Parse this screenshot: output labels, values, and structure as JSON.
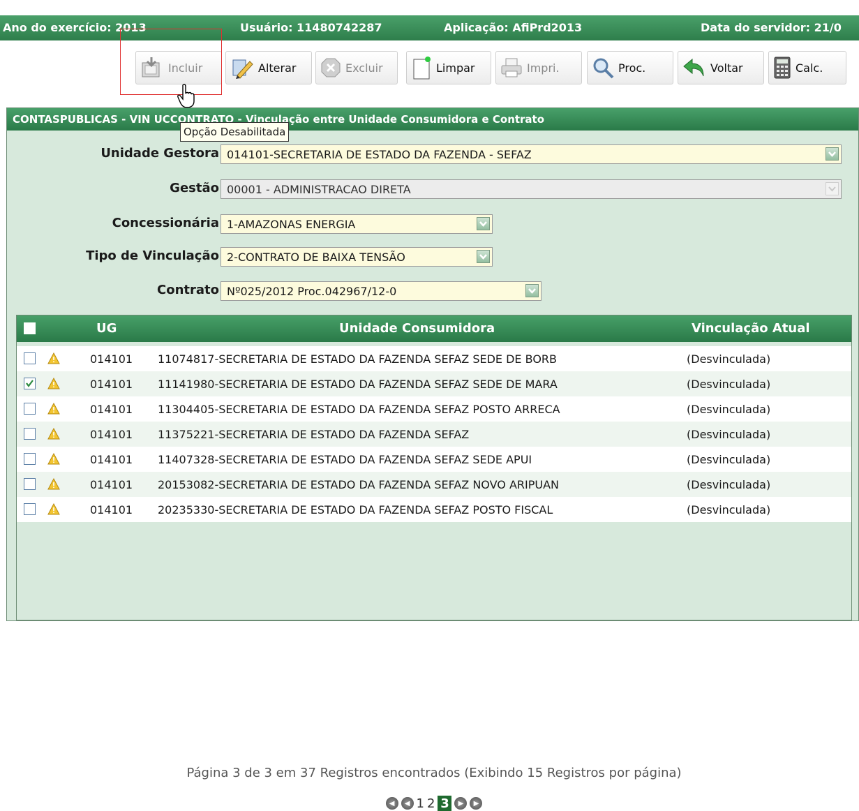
{
  "topbar": {
    "ano": "Ano do exercício: 2013",
    "usuario": "Usuário: 11480742287",
    "aplicacao": "Aplicação: AfiPrd2013",
    "data_servidor": "Data do servidor: 21/0"
  },
  "toolbar": {
    "incluir": "Incluir",
    "alterar": "Alterar",
    "excluir": "Excluir",
    "limpar": "Limpar",
    "imprimir": "Impri.",
    "proc": "Proc.",
    "voltar": "Voltar",
    "calc": "Calc."
  },
  "tooltip": "Opção Desabilitada",
  "panel": {
    "title": "CONTASPUBLICAS - VIN                              UCCONTRATO - Vinculação entre Unidade Consumidora e Contrato"
  },
  "form": {
    "unidade_gestora_label": "Unidade Gestora",
    "unidade_gestora_value": "014101-SECRETARIA DE ESTADO DA FAZENDA - SEFAZ",
    "gestao_label": "Gestão",
    "gestao_value": "00001 - ADMINISTRACAO DIRETA",
    "concessionaria_label": "Concessionária",
    "concessionaria_value": "1-AMAZONAS ENERGIA",
    "tipo_label": "Tipo de Vinculação",
    "tipo_value": "2-CONTRATO DE BAIXA TENSÃO",
    "contrato_label": "Contrato",
    "contrato_value": "Nº025/2012 Proc.042967/12-0"
  },
  "grid": {
    "headers": {
      "ug": "UG",
      "unidade": "Unidade Consumidora",
      "vinculacao": "Vinculação Atual"
    },
    "rows": [
      {
        "checked": false,
        "ug": "014101",
        "unidade": "11074817-SECRETARIA DE ESTADO DA FAZENDA SEFAZ SEDE DE BORB",
        "vinc": "(Desvinculada)"
      },
      {
        "checked": true,
        "ug": "014101",
        "unidade": "11141980-SECRETARIA DE ESTADO DA FAZENDA SEFAZ SEDE DE MARA",
        "vinc": "(Desvinculada)"
      },
      {
        "checked": false,
        "ug": "014101",
        "unidade": "11304405-SECRETARIA DE ESTADO DA FAZENDA SEFAZ POSTO ARRECA",
        "vinc": "(Desvinculada)"
      },
      {
        "checked": false,
        "ug": "014101",
        "unidade": "11375221-SECRETARIA DE ESTADO DA FAZENDA SEFAZ",
        "vinc": "(Desvinculada)"
      },
      {
        "checked": false,
        "ug": "014101",
        "unidade": "11407328-SECRETARIA DE ESTADO DA FAZENDA SEFAZ SEDE APUI",
        "vinc": "(Desvinculada)"
      },
      {
        "checked": false,
        "ug": "014101",
        "unidade": "20153082-SECRETARIA DE ESTADO DA FAZENDA SEFAZ NOVO ARIPUAN",
        "vinc": "(Desvinculada)"
      },
      {
        "checked": false,
        "ug": "014101",
        "unidade": "20235330-SECRETARIA DE ESTADO DA FAZENDA SEFAZ POSTO FISCAL",
        "vinc": "(Desvinculada)"
      }
    ],
    "pager_text": "Página 3 de 3 em 37 Registros encontrados (Exibindo 15 Registros por página)",
    "pages": [
      "1",
      "2",
      "3"
    ],
    "current_page": "3"
  },
  "colors": {
    "header_green": "#2e7e4b",
    "panel_bg": "#d7e9dc",
    "highlight_box": "#e03030",
    "current_page": "#1f6a2f"
  }
}
